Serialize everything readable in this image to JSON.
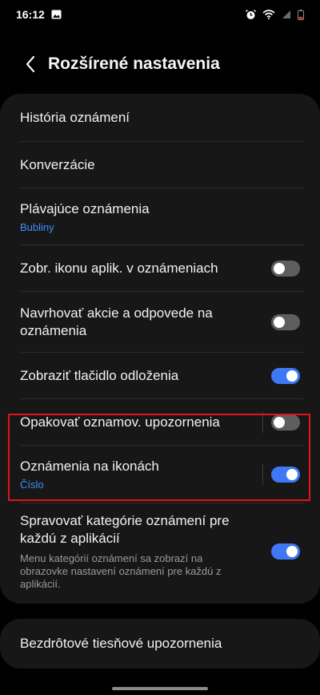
{
  "status_bar": {
    "time": "16:12",
    "left_icons": [
      "image-icon"
    ],
    "right_icons": [
      "alarm-icon",
      "wifi-icon",
      "signal-icon",
      "battery-icon"
    ]
  },
  "header": {
    "title": "Rozšírené nastavenia",
    "back_icon": "chevron-left-icon"
  },
  "settings": [
    {
      "label": "História oznámení"
    },
    {
      "label": "Konverzácie"
    },
    {
      "label": "Plávajúce oznámenia",
      "sub": "Bubliny"
    },
    {
      "label": "Zobr. ikonu aplik. v oznámeniach",
      "toggle": false
    },
    {
      "label": "Navrhovať akcie a odpovede na oznámenia",
      "toggle": false
    },
    {
      "label": "Zobraziť tlačidlo odloženia",
      "toggle": true
    },
    {
      "label": "Opakovať oznamov. upozornenia",
      "toggle": false
    },
    {
      "label": "Oznámenia na ikonách",
      "sub": "Číslo",
      "toggle": true
    },
    {
      "label": "Spravovať kategórie oznámení pre každú z aplikácií",
      "desc": "Menu kategórií oznámení sa zobrazí na obrazovke nastavení oznámení pre každú z aplikácií.",
      "toggle": true
    }
  ],
  "bottom_item": {
    "label": "Bezdrôtové tiesňové upozornenia"
  },
  "colors": {
    "background": "#010101",
    "card": "#171717",
    "accent": "#3e78f5",
    "link": "#3e91ff",
    "highlight": "#e0141e"
  }
}
